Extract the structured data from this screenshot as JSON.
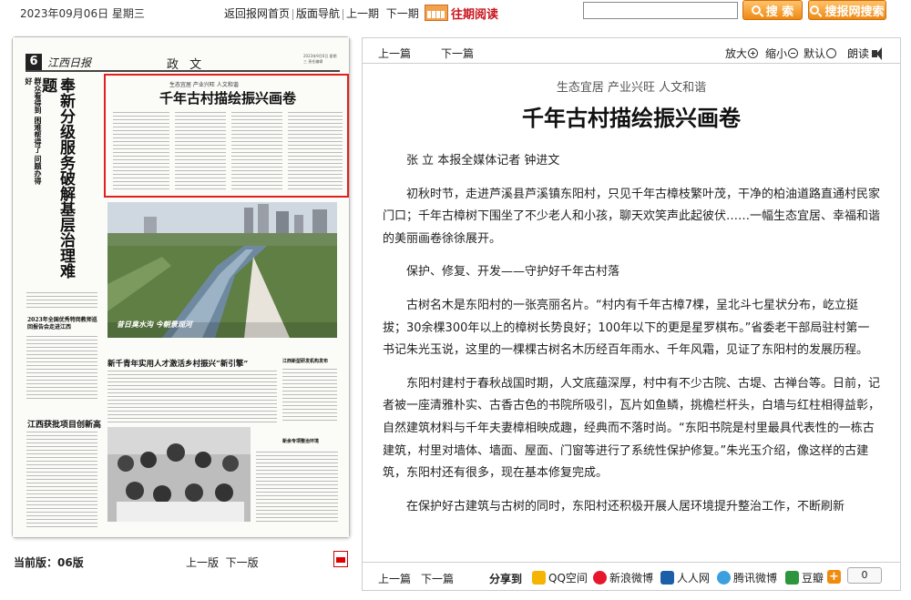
{
  "topbar": {
    "date": "2023年09月06日 星期三",
    "nav": [
      "返回报网首页",
      "版面导航",
      "上一期",
      "下一期"
    ],
    "archive_label": "往期阅读",
    "search_placeholder": "",
    "search_button": "搜 索",
    "search_site_button": "搜报网搜索"
  },
  "newspaper": {
    "page_number": "6",
    "paper_name": "江西日报",
    "section": "政 文",
    "meta": "2023年9月6日 星期三 责任编辑",
    "left_headline": "奉新分级服务破解基层治理难题",
    "left_subhead": "群众看得到 困难帮得了 问题办得好",
    "article_kicker": "生态宜居 产业兴旺 人文和谐",
    "article_title": "千年古村描绘振兴画卷",
    "photo_caption": "昔日臭水沟 今朝景观河",
    "headline_2": "新千青年实用人才激活乡村振兴“新引擎”",
    "headline_3": "2023年全国优秀特岗教师巡回报告会走进江西",
    "headline_4": "江西获批项目创新高",
    "side_head_1": "江西新型研发机构发布",
    "side_head_2": "新余专项整治环境"
  },
  "left_footer": {
    "current_label": "当前版：06版",
    "prev_page": "上一版",
    "next_page": "下一版"
  },
  "toolbar": {
    "prev": "上一篇",
    "next": "下一篇",
    "zoom_in": "放大",
    "zoom_out": "缩小",
    "default": "默认",
    "read": "朗读"
  },
  "article": {
    "kicker": "生态宜居 产业兴旺 人文和谐",
    "title": "千年古村描绘振兴画卷",
    "paragraphs": [
      "张 立 本报全媒体记者 钟进文",
      "初秋时节，走进芦溪县芦溪镇东阳村，只见千年古樟枝繁叶茂，干净的柏油道路直通村民家门口；千年古樟树下围坐了不少老人和小孩，聊天欢笑声此起彼伏……一幅生态宜居、幸福和谐的美丽画卷徐徐展开。",
      "保护、修复、开发——守护好千年古村落",
      "古树名木是东阳村的一张亮丽名片。“村内有千年古樟7棵，呈北斗七星状分布，屹立挺拔；30余棵300年以上的樟树长势良好；100年以下的更是星罗棋布。”省委老干部局驻村第一书记朱光玉说，这里的一棵棵古树名木历经百年雨水、千年风霜，见证了东阳村的发展历程。",
      "东阳村建村于春秋战国时期，人文底蕴深厚，村中有不少古院、古堤、古禅台等。日前，记者被一座清雅朴实、古香古色的书院所吸引，瓦片如鱼鳞，挑檐栏杆头，白墙与红柱相得益彰，自然建筑材料与千年夫妻樟相映成趣，经典而不落时尚。“东阳书院是村里最具代表性的一栋古建筑，村里对墙体、墙面、屋面、门窗等进行了系统性保护修复。”朱光玉介绍，像这样的古建筑，东阳村还有很多，现在基本修复完成。",
      "在保护好古建筑与古树的同时，东阳村还积极开展人居环境提升整治工作，不断刷新"
    ]
  },
  "bottom": {
    "prev": "上一篇",
    "next": "下一篇",
    "share_label": "分享到",
    "shares": [
      {
        "label": "QQ空间",
        "icon": "qzone-icon",
        "color": "#f4b400"
      },
      {
        "label": "新浪微博",
        "icon": "weibo-icon",
        "color": "#e6162d"
      },
      {
        "label": "人人网",
        "icon": "renren-icon",
        "color": "#1c5fa8"
      },
      {
        "label": "腾讯微博",
        "icon": "tencent-weibo-icon",
        "color": "#3aa0e0"
      },
      {
        "label": "豆瓣",
        "icon": "douban-icon",
        "color": "#2d963d"
      }
    ],
    "more_icon": "plus-icon",
    "count": "0"
  }
}
